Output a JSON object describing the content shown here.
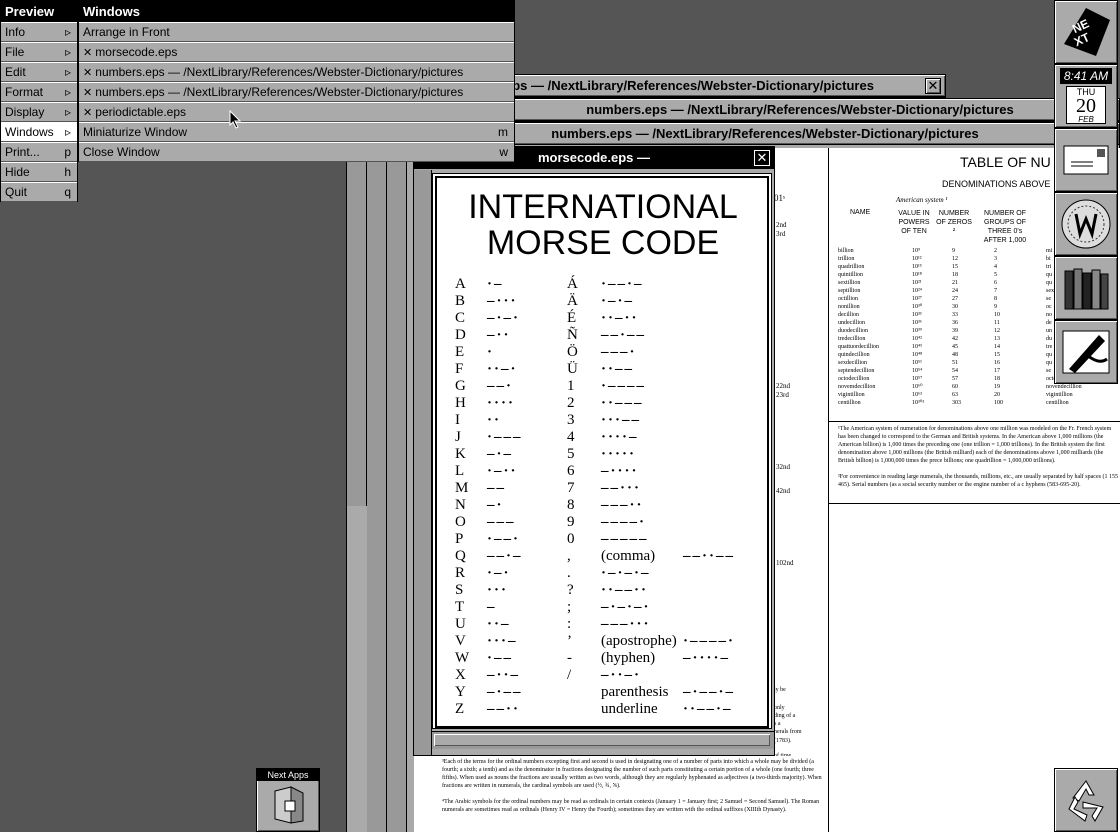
{
  "main_menu": {
    "title": "Preview",
    "items": [
      {
        "label": "Info",
        "key": "▹"
      },
      {
        "label": "File",
        "key": "▹"
      },
      {
        "label": "Edit",
        "key": "▹"
      },
      {
        "label": "Format",
        "key": "▹"
      },
      {
        "label": "Display",
        "key": "▹"
      },
      {
        "label": "Windows",
        "key": "▹"
      },
      {
        "label": "Print...",
        "key": "p"
      },
      {
        "label": "Hide",
        "key": "h"
      },
      {
        "label": "Quit",
        "key": "q"
      }
    ]
  },
  "windows_menu": {
    "title": "Windows",
    "items": [
      {
        "label": "Arrange in Front",
        "key": ""
      },
      {
        "label": "morsecode.eps",
        "key": ""
      },
      {
        "label": "numbers.eps  —  /NextLibrary/References/Webster-Dictionary/pictures",
        "key": ""
      },
      {
        "label": "numbers.eps  —  /NextLibrary/References/Webster-Dictionary/pictures",
        "key": ""
      },
      {
        "label": "periodictable.eps",
        "key": ""
      },
      {
        "label": "Miniaturize Window",
        "key": "m"
      },
      {
        "label": "Close Window",
        "key": "w"
      }
    ]
  },
  "back_windows": {
    "w1_title": "eps  —  /NextLibrary/References/Webster-Dictionary/pictures",
    "w2_title": "numbers.eps  —  /NextLibrary/References/Webster-Dictionary/pictures",
    "w3_title": "numbers.eps  —  /NextLibrary/References/Webster-Dictionary/pictures"
  },
  "morse_window": {
    "title": "morsecode.eps  —",
    "heading_line1": "INTERNATIONAL",
    "heading_line2": "MORSE CODE"
  },
  "morse_rows": [
    {
      "l": "A",
      "c": "·–",
      "l2": "Á",
      "c2": "·––·–"
    },
    {
      "l": "B",
      "c": "–···",
      "l2": "Ä",
      "c2": "·–·–"
    },
    {
      "l": "C",
      "c": "–·–·",
      "l2": "É",
      "c2": "··–··"
    },
    {
      "l": "D",
      "c": "–··",
      "l2": "Ñ",
      "c2": "––·––"
    },
    {
      "l": "E",
      "c": "·",
      "l2": "Ö",
      "c2": "–––·"
    },
    {
      "l": "F",
      "c": "··–·",
      "l2": "Ü",
      "c2": "··––"
    },
    {
      "l": "G",
      "c": "––·",
      "l2": "1",
      "c2": "·––––"
    },
    {
      "l": "H",
      "c": "····",
      "l2": "2",
      "c2": "··–––"
    },
    {
      "l": "I",
      "c": "··",
      "l2": "3",
      "c2": "···––"
    },
    {
      "l": "J",
      "c": "·–––",
      "l2": "4",
      "c2": "····–"
    },
    {
      "l": "K",
      "c": "–·–",
      "l2": "5",
      "c2": "·····"
    },
    {
      "l": "L",
      "c": "·–··",
      "l2": "6",
      "c2": "–····"
    },
    {
      "l": "M",
      "c": "––",
      "l2": "7",
      "c2": "––···"
    },
    {
      "l": "N",
      "c": "–·",
      "l2": "8",
      "c2": "–––··"
    },
    {
      "l": "O",
      "c": "–––",
      "l2": "9",
      "c2": "––––·"
    },
    {
      "l": "P",
      "c": "·––·",
      "l2": "0",
      "c2": "–––––"
    },
    {
      "l": "Q",
      "c": "––·–",
      "l2": ",",
      "c2": "(comma)",
      "c3": "––··––"
    },
    {
      "l": "R",
      "c": "·–·",
      "l2": ".",
      "c2": "·–·–·–"
    },
    {
      "l": "S",
      "c": "···",
      "l2": "?",
      "c2": "··––··"
    },
    {
      "l": "T",
      "c": "–",
      "l2": ";",
      "c2": "–·–·–·"
    },
    {
      "l": "U",
      "c": "··–",
      "l2": ":",
      "c2": "–––···"
    },
    {
      "l": "V",
      "c": "···–",
      "l2": "’",
      "c2": "(apostrophe)",
      "c3": "·––––·"
    },
    {
      "l": "W",
      "c": "·––",
      "l2": "-",
      "c2": "(hyphen)",
      "c3": "–····–"
    },
    {
      "l": "X",
      "c": "–··–",
      "l2": "/",
      "c2": "–··–·"
    },
    {
      "l": "Y",
      "c": "–·––",
      "l2": "",
      "c2": "parenthesis",
      "c3": "–·––·–"
    },
    {
      "l": "Z",
      "c": "––··",
      "l2": "",
      "c2": "underline",
      "c3": "··––·–"
    }
  ],
  "numbers_doc": {
    "title": "TABLE OF NU",
    "subtitle": "DENOMINATIONS ABOVE",
    "system_label": "American system ¹",
    "col_name": "NAME",
    "col_value": "VALUE IN POWERS OF TEN",
    "col_zeros": "NUMBER OF ZEROS ²",
    "col_groups": "NUMBER OF GROUPS OF THREE 0's AFTER 1,000",
    "rows": [
      [
        "billion",
        "10⁹",
        "9",
        "2"
      ],
      [
        "trillion",
        "10¹²",
        "12",
        "3"
      ],
      [
        "quadrillion",
        "10¹⁵",
        "15",
        "4"
      ],
      [
        "quintillion",
        "10¹⁸",
        "18",
        "5"
      ],
      [
        "sextillion",
        "10²¹",
        "21",
        "6"
      ],
      [
        "septillion",
        "10²⁴",
        "24",
        "7"
      ],
      [
        "octillion",
        "10²⁷",
        "27",
        "8"
      ],
      [
        "nonillion",
        "10³⁰",
        "30",
        "9"
      ],
      [
        "decillion",
        "10³³",
        "33",
        "10"
      ],
      [
        "undecillion",
        "10³⁶",
        "36",
        "11"
      ],
      [
        "duodecillion",
        "10³⁹",
        "39",
        "12"
      ],
      [
        "tredecillion",
        "10⁴²",
        "42",
        "13"
      ],
      [
        "quattuordecillion",
        "10⁴⁵",
        "45",
        "14"
      ],
      [
        "quindecillion",
        "10⁴⁸",
        "48",
        "15"
      ],
      [
        "sexdecillion",
        "10⁵¹",
        "51",
        "16"
      ],
      [
        "septendecillion",
        "10⁵⁴",
        "54",
        "17"
      ],
      [
        "octodecillion",
        "10⁵⁷",
        "57",
        "18"
      ],
      [
        "novemdecillion",
        "10⁶⁰",
        "60",
        "19"
      ],
      [
        "vigintillion",
        "10⁶³",
        "63",
        "20"
      ],
      [
        "centillion",
        "10³⁰³",
        "303",
        "100"
      ]
    ],
    "right_names": [
      "mi",
      "bi",
      "tri",
      "qu",
      "qu",
      "sex",
      "se",
      "oc",
      "no",
      "de",
      "un",
      "du",
      "tre",
      "qu",
      "qu",
      "se",
      "octodecillion",
      "novendecillion",
      "vigintillion",
      "centillion"
    ],
    "footnote1": "¹The American system of numeration for denominations above one million was modeled on the Fr. French system has been changed to correspond to the German and British systems. In the American above 1,000 millions (the American billion) is 1,000 times the preceding one (one trillion = 1,000 trillions). In the British system the first denomination above 1,000 millions (the British milliard) each of the denominations above 1,000 milliards (the British billion) is 1,000,000 times the prece billions; one quadrillion = 1,000,000 trillions).",
    "footnote2": "²For convenience in reading large numerals, the thousands, millions, etc., are usually separated by half spaces (1 155 465). Serial numbers (as a social security number or the engine number of a c hyphens (583-695-20).",
    "ordinal_labels": [
      "01ˢ",
      "2nd",
      "3rd",
      "22nd",
      "23rd",
      "32nd",
      "42nd",
      "102nd"
    ],
    "footnote3": "³Each of the terms for the ordinal numbers excepting first and second is used in designating one of a number of parts into which a whole may be divided (a fourth; a sixth; a tenth) and as the denominator in fractions designating the number of such parts constituting a certain portion of a whole (one fourth; three fifths). When used as nouns the fractions are usually written as two words, although they are regularly hyphenated as adjectives (a two-thirds majority). When fractions are written in numerals, the cardinal symbols are used (½, ¾, ⅝).",
    "footnote4": "⁴The Arabic symbols for the ordinal numbers may be read as ordinals in certain contexts (January 1 = January first; 2 Samuel = Second Samuel). The Roman numerals are sometimes read as ordinals (Henry IV = Henry the Fourth); sometimes they are written with the ordinal suffixes (XIIIth Dynasty).",
    "side_snips": [
      "ly be",
      "only",
      "ding of a",
      "s a",
      "nerals from",
      "(1783).",
      "of time"
    ]
  },
  "dock": {
    "clock_time": "8:41 AM",
    "clock_day": "THU",
    "clock_date": "20",
    "clock_month": "FEB",
    "next_apps_label": "Next Apps"
  }
}
